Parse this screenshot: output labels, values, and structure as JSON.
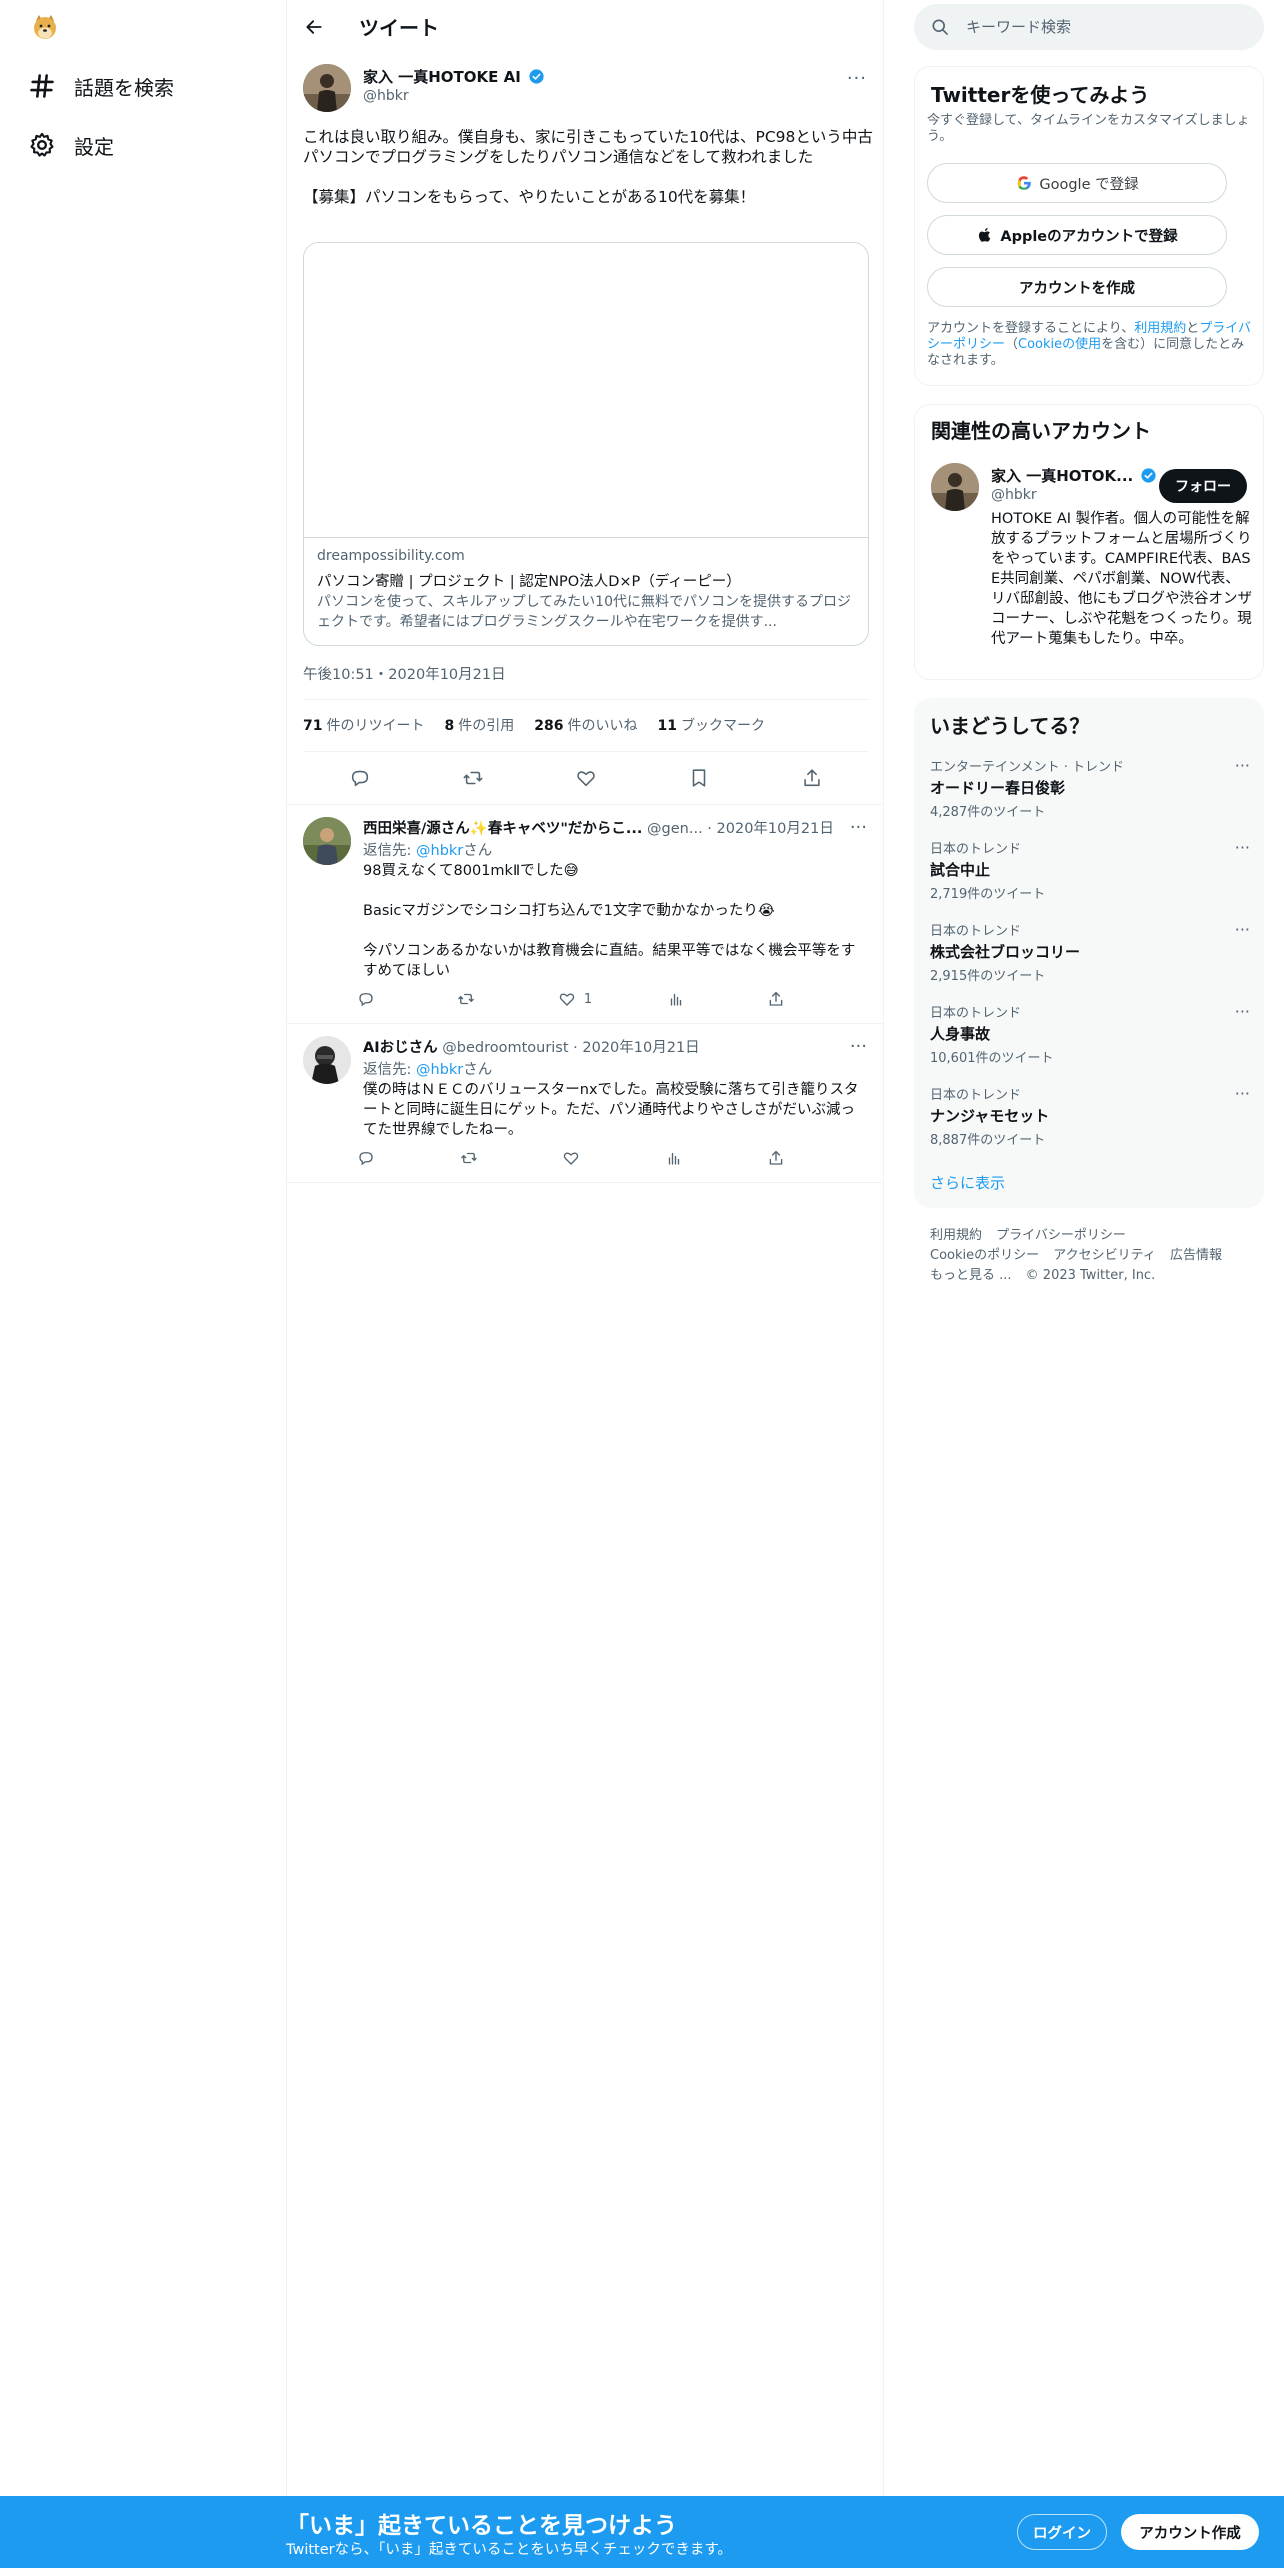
{
  "nav": {
    "explore_label": "話題を検索",
    "settings_label": "設定"
  },
  "header": {
    "title": "ツイート"
  },
  "tweet": {
    "author_name": "家入 一真HOTOKE AI",
    "author_handle": "@hbkr",
    "text": "これは良い取り組み。僕自身も、家に引きこもっていた10代は、PC98という中古パソコンでプログラミングをしたりパソコン通信などをして救われました\n\n【募集】パソコンをもらって、やりたいことがある10代を募集！",
    "card": {
      "domain": "dreampossibility.com",
      "title": "パソコン寄贈 | プロジェクト | 認定NPO法人D×P（ディーピー）",
      "description": "パソコンを使って、スキルアップしてみたい10代に無料でパソコンを提供するプロジェクトです。希望者にはプログラミングスクールや在宅ワークを提供す..."
    },
    "time": "午後10:51・2020年10月21日",
    "stats": {
      "retweets_count": "71",
      "retweets_label": "件のリツイート",
      "quotes_count": "8",
      "quotes_label": "件の引用",
      "likes_count": "286",
      "likes_label": "件のいいね",
      "bookmarks_count": "11",
      "bookmarks_label": "ブックマーク"
    }
  },
  "replies": [
    {
      "name": "西田栄喜/源さん✨春キャベツ\"だからこ...",
      "meta": "@gen... · 2020年10月21日",
      "reply_to_prefix": "返信先: ",
      "reply_to_mention": "@hbkr",
      "reply_to_suffix": "さん",
      "text": "98買えなくて8001mkⅡでした😅\n\nBasicマガジンでシコシコ打ち込んで1文字で動かなかったり😭\n\n今パソコンあるかないかは教育機会に直結。結果平等ではなく機会平等をすすめてほしい",
      "likes": "1"
    },
    {
      "name": "AIおじさん",
      "meta": "@bedroomtourist · 2020年10月21日",
      "reply_to_prefix": "返信先: ",
      "reply_to_mention": "@hbkr",
      "reply_to_suffix": "さん",
      "text": "僕の時はＮＥＣのバリュースターnxでした。高校受験に落ちて引き籠りスタートと同時に誕生日にゲット。ただ、パソ通時代よりやさしさがだいぶ減ってた世界線でしたねー。",
      "likes": ""
    }
  ],
  "search": {
    "placeholder": "キーワード検索"
  },
  "signup_panel": {
    "title": "Twitterを使ってみよう",
    "subtitle": "今すぐ登録して、タイムラインをカスタマイズしましょう。",
    "google_label": "Google で登録",
    "apple_label": "Appleのアカウントで登録",
    "create_label": "アカウントを作成",
    "legal_1": "アカウントを登録することにより、",
    "legal_terms": "利用規約",
    "legal_2": "と",
    "legal_privacy": "プライバシーポリシー",
    "legal_3": "（",
    "legal_cookie": "Cookieの使用",
    "legal_4": "を含む）に同意したとみなされます。"
  },
  "related": {
    "title": "関連性の高いアカウント",
    "name": "家入 一真HOTOK...",
    "handle": "@hbkr",
    "follow_label": "フォロー",
    "bio": "HOTOKE AI 製作者。個人の可能性を解放するプラットフォームと居場所づくりをやっています。CAMPFIRE代表、BASE共同創業、ペパボ創業、NOW代表、リバ邸創設、他にもブログや渋谷オンザコーナー、しぶや花魁をつくったり。現代アート蒐集もしたり。中卒。"
  },
  "trends": {
    "title": "いまどうしてる？",
    "items": [
      {
        "category": "エンターテインメント · トレンド",
        "name": "オードリー春日俊彰",
        "count": "4,287件のツイート"
      },
      {
        "category": "日本のトレンド",
        "name": "試合中止",
        "count": "2,719件のツイート"
      },
      {
        "category": "日本のトレンド",
        "name": "株式会社ブロッコリー",
        "count": "2,915件のツイート"
      },
      {
        "category": "日本のトレンド",
        "name": "人身事故",
        "count": "10,601件のツイート"
      },
      {
        "category": "日本のトレンド",
        "name": "ナンジャモセット",
        "count": "8,887件のツイート"
      }
    ],
    "show_more": "さらに表示"
  },
  "footer": {
    "terms": "利用規約",
    "privacy": "プライバシーポリシー",
    "cookie": "Cookieのポリシー",
    "accessibility": "アクセシビリティ",
    "ads": "広告情報",
    "more": "もっと見る ...",
    "copyright": "© 2023 Twitter, Inc."
  },
  "bottom_bar": {
    "title": "「いま」起きていることを見つけよう",
    "subtitle": "Twitterなら、「いま」起きていることをいち早くチェックできます。",
    "login_label": "ログイン",
    "signup_label": "アカウント作成"
  },
  "colors": {
    "accent": "#1d9bf0",
    "text": "#0f1419",
    "muted": "#536471"
  }
}
